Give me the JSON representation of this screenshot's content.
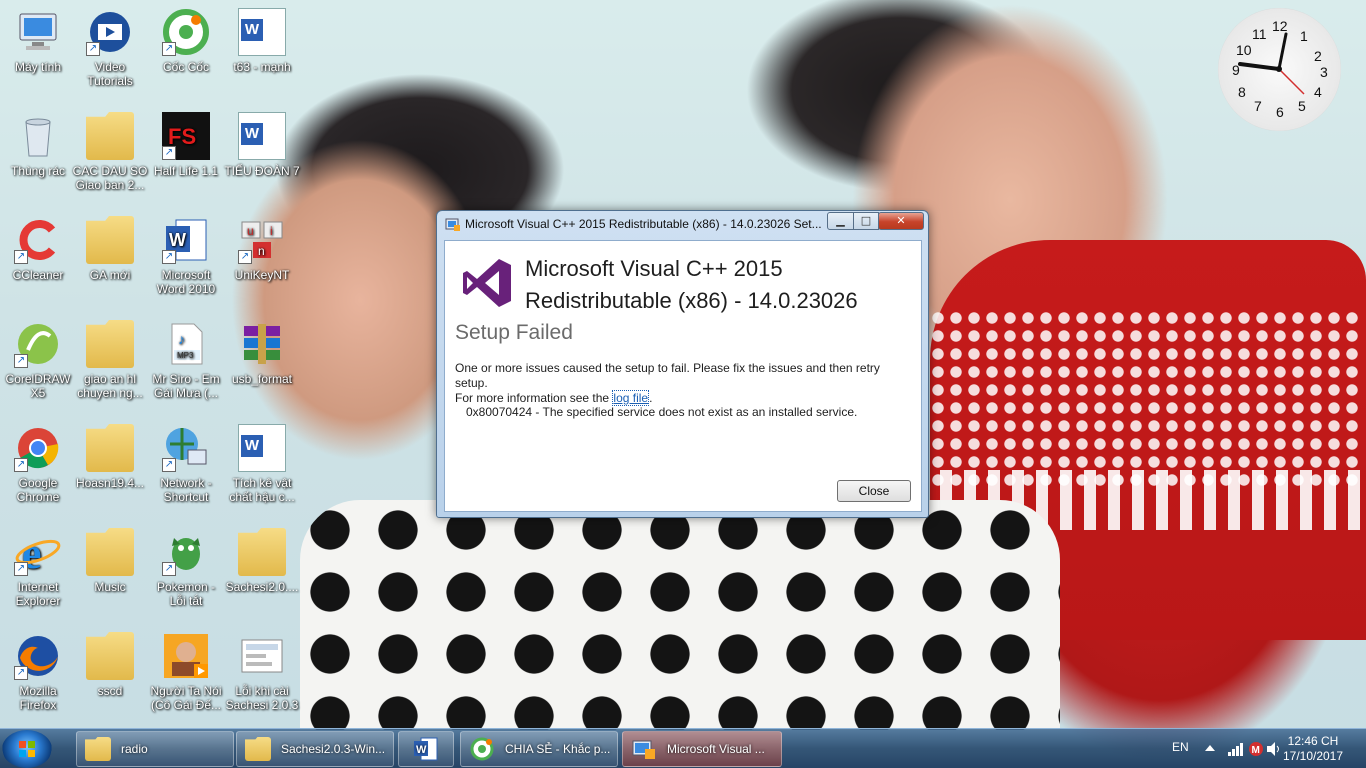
{
  "desktop": {
    "icons": [
      {
        "label": "Máy tính",
        "icon": "computer-icon"
      },
      {
        "label": "Video Tutorials",
        "icon": "video-icon"
      },
      {
        "label": "Cốc Cốc",
        "icon": "coccoc-icon"
      },
      {
        "label": "t63 - mạnh",
        "icon": "word-doc-icon"
      },
      {
        "label": "Thùng rác",
        "icon": "recycle-bin-icon"
      },
      {
        "label": "CAC DAU SO Giao ban 2...",
        "icon": "folder-icon"
      },
      {
        "label": "Half Life 1.1",
        "icon": "halflife-icon"
      },
      {
        "label": "TIỂU ĐOÀN 7",
        "icon": "word-doc-icon"
      },
      {
        "label": "CCleaner",
        "icon": "ccleaner-icon"
      },
      {
        "label": "GA mới",
        "icon": "folder-icon"
      },
      {
        "label": "Microsoft Word 2010",
        "icon": "word-icon"
      },
      {
        "label": "UniKeyNT",
        "icon": "unikey-icon"
      },
      {
        "label": "CorelDRAW X5",
        "icon": "coreldraw-icon"
      },
      {
        "label": "giao an hl chuyen ng...",
        "icon": "folder-icon"
      },
      {
        "label": "Mr Siro - Em Gái Mưa (...",
        "icon": "mp3-icon"
      },
      {
        "label": "usb_format",
        "icon": "winrar-icon"
      },
      {
        "label": "Google Chrome",
        "icon": "chrome-icon"
      },
      {
        "label": "Hoasn19.4...",
        "icon": "folder-icon"
      },
      {
        "label": "Network - Shortcut",
        "icon": "network-icon"
      },
      {
        "label": "Tích kê vật chất hậu c...",
        "icon": "word-doc-icon"
      },
      {
        "label": "Internet Explorer",
        "icon": "ie-icon"
      },
      {
        "label": "Music",
        "icon": "folder-icon"
      },
      {
        "label": "Pokemon - Lỗi tắt",
        "icon": "pokemon-icon"
      },
      {
        "label": "Sachesi2.0....",
        "icon": "folder-icon"
      },
      {
        "label": "Mozilla Firefox",
        "icon": "firefox-icon"
      },
      {
        "label": "sscd",
        "icon": "folder-icon"
      },
      {
        "label": "Người Ta Nói (Cô Gái Đế...",
        "icon": "media-icon"
      },
      {
        "label": "Lỗi khi cài Sachesi 2.0.3",
        "icon": "image-icon"
      }
    ]
  },
  "clock": {
    "numerals": [
      "12",
      "1",
      "2",
      "3",
      "4",
      "5",
      "6",
      "7",
      "8",
      "9",
      "10",
      "11"
    ]
  },
  "dialog": {
    "title": "Microsoft Visual C++ 2015 Redistributable (x86) - 14.0.23026 Set...",
    "min_label": "▁",
    "max_label": "□",
    "close_label": "✕",
    "product_title_line1": "Microsoft Visual C++ 2015",
    "product_title_line2": "Redistributable (x86) - 14.0.23026",
    "status": "Setup Failed",
    "message_line1": "One or more issues caused the setup to fail. Please fix the issues and then retry setup.",
    "message_line2_prefix": "For more information see the ",
    "log_link": "log file",
    "message_line2_suffix": ".",
    "error": "0x80070424 - The specified service does not exist as an installed service.",
    "close_button": "Close"
  },
  "taskbar": {
    "items": [
      {
        "label": "radio",
        "icon": "folder-icon"
      },
      {
        "label": "Sachesi2.0.3-Win...",
        "icon": "folder-icon"
      },
      {
        "label": "",
        "icon": "word-icon"
      },
      {
        "label": "CHIA SẺ - Khắc p...",
        "icon": "coccoc-icon"
      },
      {
        "label": "Microsoft Visual ...",
        "icon": "installer-icon"
      }
    ],
    "language": "EN",
    "time": "12:46 CH",
    "date": "17/10/2017"
  }
}
